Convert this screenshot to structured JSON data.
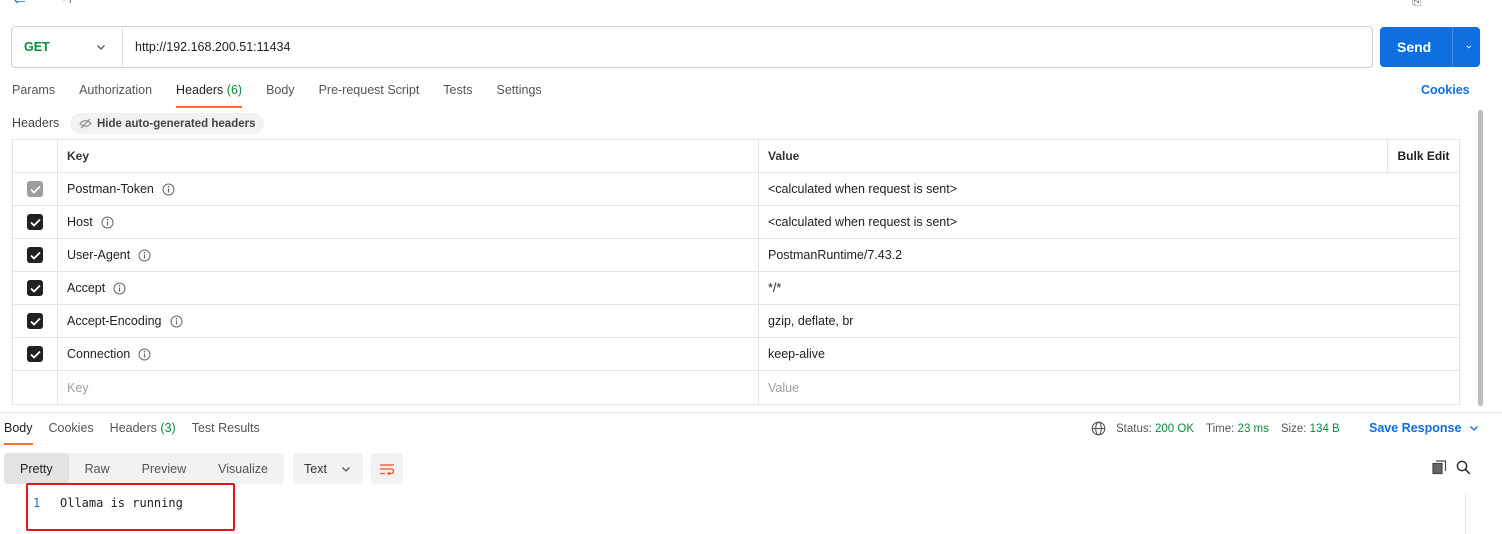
{
  "request": {
    "method": "GET",
    "url": "http://192.168.200.51:11434",
    "send_label": "Send"
  },
  "req_tabs": [
    {
      "label": "Params"
    },
    {
      "label": "Authorization"
    },
    {
      "label": "Headers",
      "count": "(6)"
    },
    {
      "label": "Body"
    },
    {
      "label": "Pre-request Script"
    },
    {
      "label": "Tests"
    },
    {
      "label": "Settings"
    }
  ],
  "cookies_label": "Cookies",
  "headers_section": {
    "label": "Headers",
    "hide_auto": "Hide auto-generated headers",
    "col_key": "Key",
    "col_value": "Value",
    "bulk_edit": "Bulk Edit",
    "rows": [
      {
        "key": "Postman-Token",
        "value": "<calculated when request is sent>",
        "checked": true,
        "disabled": true
      },
      {
        "key": "Host",
        "value": "<calculated when request is sent>",
        "checked": true,
        "disabled": false
      },
      {
        "key": "User-Agent",
        "value": "PostmanRuntime/7.43.2",
        "checked": true,
        "disabled": false
      },
      {
        "key": "Accept",
        "value": "*/*",
        "checked": true,
        "disabled": false
      },
      {
        "key": "Accept-Encoding",
        "value": "gzip, deflate, br",
        "checked": true,
        "disabled": false
      },
      {
        "key": "Connection",
        "value": "keep-alive",
        "checked": true,
        "disabled": false
      }
    ],
    "placeholder_key": "Key",
    "placeholder_value": "Value"
  },
  "resp_tabs": [
    {
      "label": "Body"
    },
    {
      "label": "Cookies"
    },
    {
      "label": "Headers",
      "count": "(3)"
    },
    {
      "label": "Test Results"
    }
  ],
  "response_meta": {
    "status_label": "Status:",
    "status_value": "200 OK",
    "time_label": "Time:",
    "time_value": "23 ms",
    "size_label": "Size:",
    "size_value": "134 B",
    "save_label": "Save Response"
  },
  "format": {
    "modes": [
      "Pretty",
      "Raw",
      "Preview",
      "Visualize"
    ],
    "active": "Pretty",
    "type": "Text"
  },
  "body_lines": [
    {
      "no": "1",
      "text": "Ollama is running"
    }
  ],
  "colors": {
    "accent": "#0d6fe0",
    "method_get": "#0b8a3e",
    "tab_underline": "#ff6c37",
    "highlight_box": "#e0151d"
  }
}
